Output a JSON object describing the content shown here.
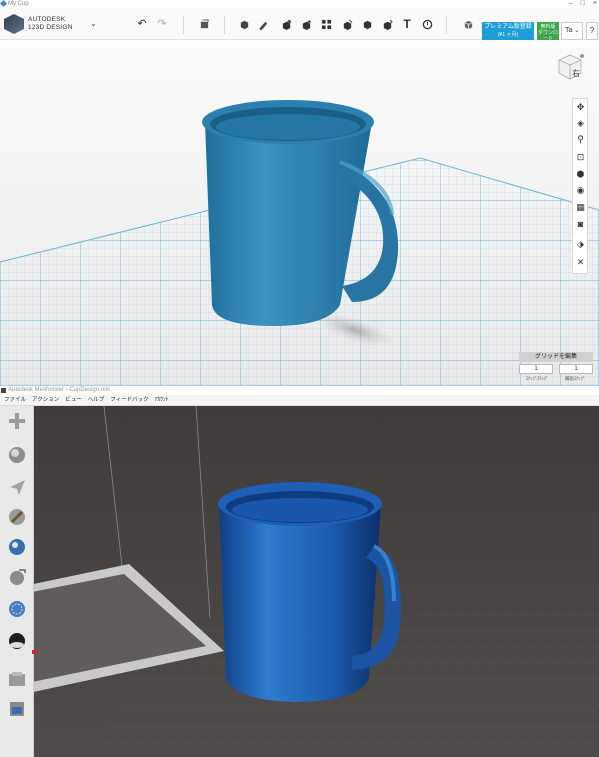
{
  "top_app": {
    "window_title": "My Cup",
    "logo": {
      "line1": "AUTODESK",
      "line2": "123D DESIGN"
    },
    "premium_button": {
      "line1": "プレミアム版登録",
      "line2": "(¥1 ヶ月)"
    },
    "green_button": {
      "line1": "無料版",
      "line2": "ダウンロード"
    },
    "user_menu_label": "Ta",
    "help_label": "?",
    "viewcube_label": "右",
    "grid_panel": {
      "title": "グリッドを編集",
      "snap_value": "1",
      "minor_value": "1",
      "snap_label": "ｽﾅｯﾌﾟｽﾅｯﾌﾟ",
      "minor_label": "補助ｽﾅｯﾌﾟ"
    },
    "colors": {
      "mug": "#2a7fae",
      "grid": "#7cc3dd",
      "accent": "#1f9fd8"
    }
  },
  "bottom_app": {
    "window_title": "Autodesk Meshmixer - CupDesign.mix",
    "menu": [
      "ファイル",
      "アクション",
      "ビュー",
      "ヘルプ",
      "フィードバック",
      "ｱｶｳﾝﾄ"
    ],
    "tools": [
      "import-icon",
      "meshmix-icon",
      "select-icon",
      "sculpt-icon",
      "stamp-icon",
      "edit-icon",
      "analysis-icon",
      "shaders-icon",
      "export-icon",
      "print-icon"
    ],
    "colors": {
      "mug": "#1d5fae",
      "background": "#4a4745",
      "build_plate": "#5f5c5a"
    }
  }
}
